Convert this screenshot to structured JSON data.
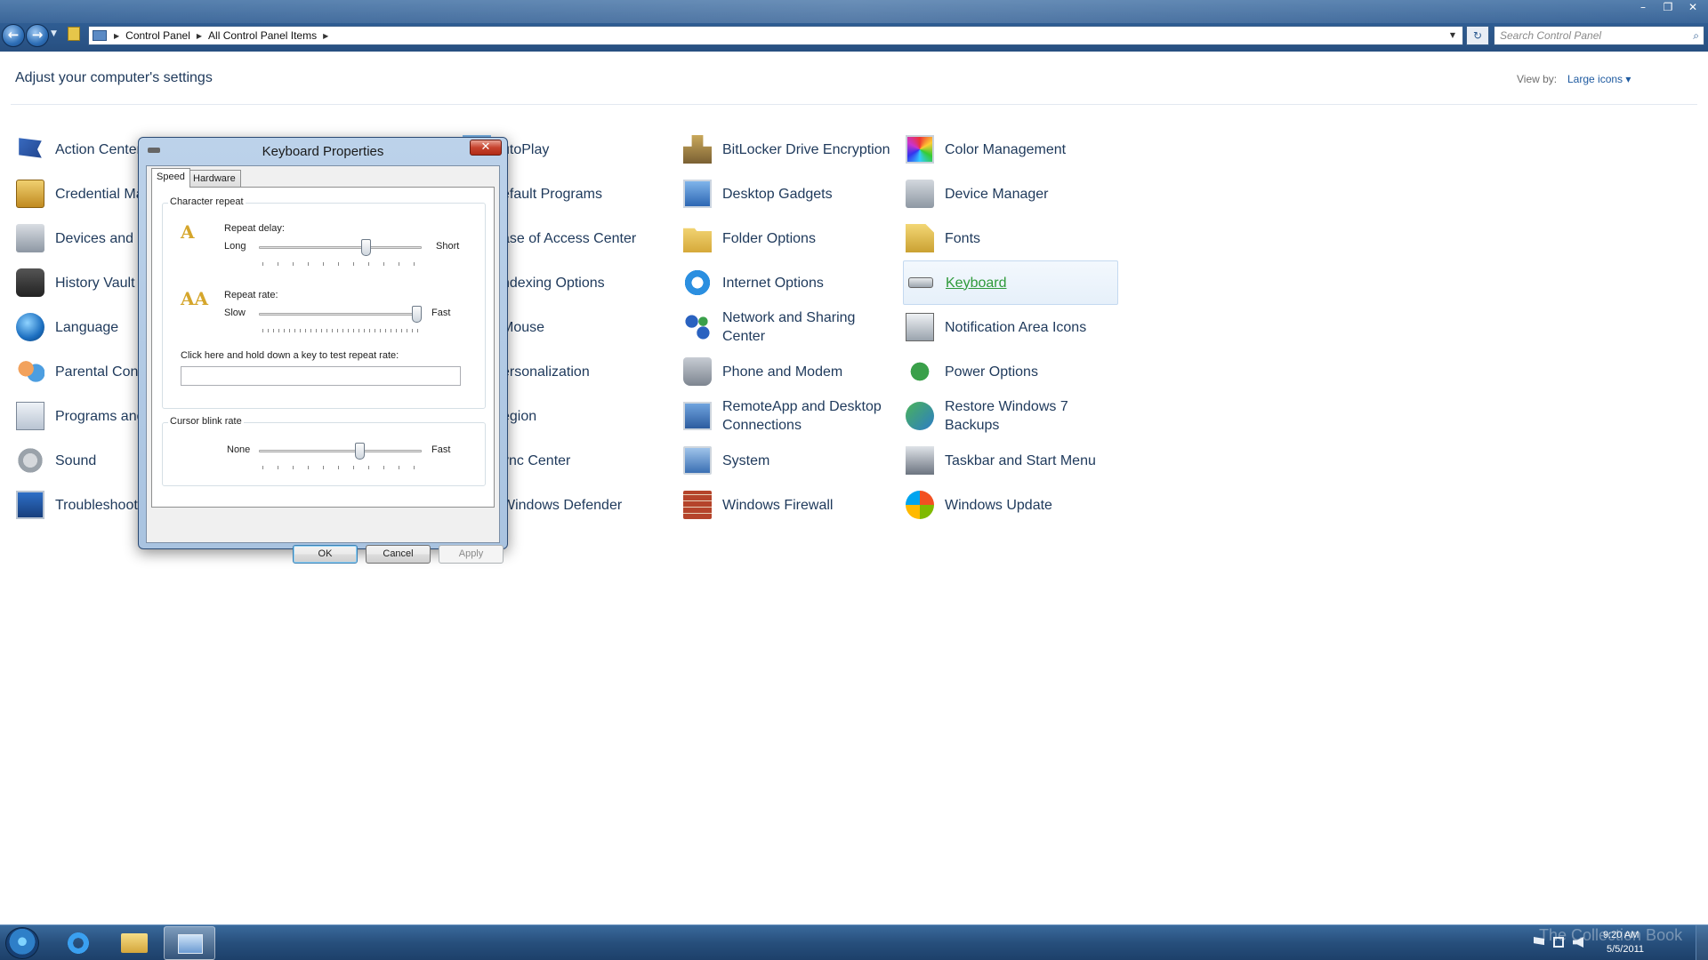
{
  "window": {
    "minimize": "–",
    "maximize": "❐",
    "close": "✕"
  },
  "nav": {
    "back_glyph": "←",
    "forward_glyph": "→"
  },
  "address": {
    "crumbs": [
      "Control Panel",
      "All Control Panel Items"
    ],
    "refresh_glyph": "↻"
  },
  "search": {
    "placeholder": "Search Control Panel"
  },
  "header": {
    "title": "Adjust your computer's settings",
    "view_by_label": "View by:",
    "view_by_value": "Large icons ▾"
  },
  "items": {
    "col1": [
      "Action Center",
      "Credential Ma",
      "Devices and P",
      "History Vault",
      "Language",
      "Parental Cont",
      "Programs and",
      "Sound",
      "Troubleshooti"
    ],
    "col3": [
      "utoPlay",
      "efault Programs",
      "ase of Access Center",
      "ndexing Options",
      "Mouse",
      "ersonalization",
      "egion",
      "ync Center",
      "Windows Defender"
    ],
    "col4": [
      "BitLocker Drive Encryption",
      "Desktop Gadgets",
      "Folder Options",
      "Internet Options",
      "Network and Sharing Center",
      "Phone and Modem",
      "RemoteApp and Desktop Connections",
      "System",
      "Windows Firewall"
    ],
    "col5": [
      "Color Management",
      "Device Manager",
      "Fonts",
      "Keyboard",
      "Notification Area Icons",
      "Power Options",
      "Restore Windows 7 Backups",
      "Taskbar and Start Menu",
      "Windows Update"
    ],
    "selected": "Keyboard"
  },
  "dialog": {
    "title": "Keyboard Properties",
    "close_glyph": "✕",
    "tabs": [
      "Speed",
      "Hardware"
    ],
    "character_repeat": {
      "group_title": "Character repeat",
      "repeat_delay_label": "Repeat delay:",
      "delay_min": "Long",
      "delay_max": "Short",
      "delay_value": 0.67,
      "repeat_rate_label": "Repeat rate:",
      "rate_min": "Slow",
      "rate_max": "Fast",
      "rate_value": 1.0,
      "test_label": "Click here and hold down a key to test repeat rate:",
      "test_value": ""
    },
    "cursor_blink": {
      "group_title": "Cursor blink rate",
      "min": "None",
      "max": "Fast",
      "value": 0.63
    },
    "buttons": {
      "ok": "OK",
      "cancel": "Cancel",
      "apply": "Apply"
    }
  },
  "taskbar": {
    "clock_time": "9:20 AM",
    "clock_date": "5/5/2011",
    "watermark": "The Collection Book"
  }
}
